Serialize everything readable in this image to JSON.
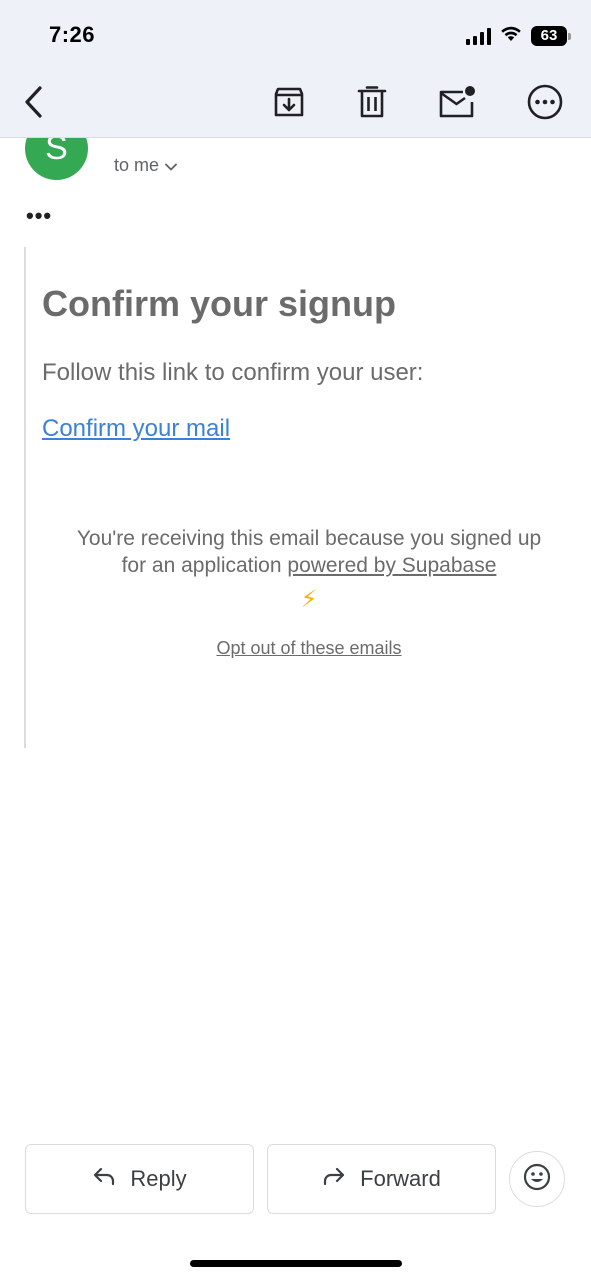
{
  "status_bar": {
    "time": "7:26",
    "battery_level": "63",
    "icons": [
      "cellular-signal-icon",
      "wifi-icon",
      "battery-icon"
    ]
  },
  "toolbar": {
    "icons": [
      "back-arrow-icon",
      "archive-icon",
      "trash-icon",
      "mark-unread-icon",
      "more-options-icon"
    ]
  },
  "sender": {
    "avatar_letter": "S",
    "avatar_color": "#34a853",
    "recipient_label": "to me"
  },
  "email": {
    "heading": "Confirm your signup",
    "body_text": "Follow this link to confirm your user:",
    "confirm_link": "Confirm your mail",
    "footer_text": "You're receiving this email because you signed up for an application",
    "footer_link": "powered by Supabase",
    "bolt": "⚡",
    "opt_out_link": "Opt out of these emails",
    "link_color": "#3b82d6"
  },
  "actions": {
    "reply_label": "Reply",
    "forward_label": "Forward"
  }
}
